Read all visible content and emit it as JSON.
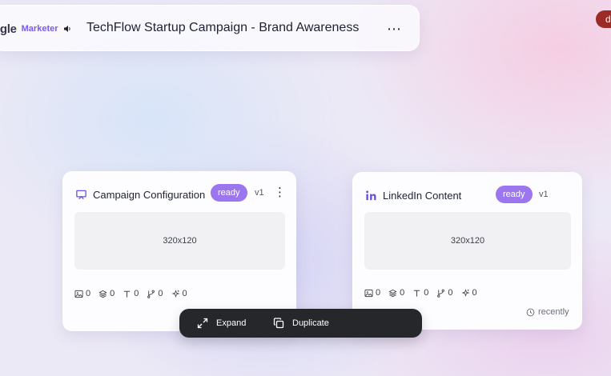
{
  "header": {
    "brand_name": "ogle",
    "brand_sub": "Marketer",
    "title": "TechFlow Startup Campaign - Brand Awareness",
    "more": "⋯"
  },
  "avatar": {
    "initial": "d",
    "color": "#9c2b25"
  },
  "cards": [
    {
      "title": "Campaign Configuration",
      "status": "ready",
      "version": "v1",
      "menu": "⋮",
      "icon": "presentation-icon",
      "placeholder": "320x120",
      "stats": [
        "0",
        "0",
        "0",
        "0",
        "0"
      ]
    },
    {
      "title": "LinkedIn Content",
      "status": "ready",
      "version": "v1",
      "icon": "linkedin-icon",
      "placeholder": "320x120",
      "stats": [
        "0",
        "0",
        "0",
        "0",
        "0"
      ],
      "updated": "recently"
    }
  ],
  "toolbar": {
    "expand": "Expand",
    "duplicate": "Duplicate"
  },
  "colors": {
    "accent": "#7b5ae8",
    "badge": "#9b76ee",
    "toolbar_bg": "#26272b"
  }
}
